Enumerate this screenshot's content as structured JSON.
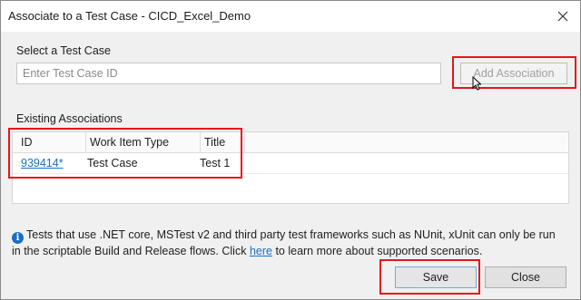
{
  "window": {
    "title": "Associate to a Test Case - CICD_Excel_Demo"
  },
  "select_section": {
    "label": "Select a Test Case",
    "input_placeholder": "Enter Test Case ID",
    "input_value": "",
    "add_button_label": "Add Association"
  },
  "associations": {
    "label": "Existing Associations",
    "columns": [
      "ID",
      "Work Item Type",
      "Title"
    ],
    "rows": [
      {
        "id": "939414*",
        "work_item_type": "Test Case",
        "title": "Test 1"
      }
    ]
  },
  "info": {
    "text_before_link": "Tests that use .NET core, MSTest v2 and third party test frameworks such as NUnit, xUnit can only be run in the scriptable Build and Release flows. Click ",
    "link_text": "here",
    "text_after_link": " to learn more about supported scenarios."
  },
  "footer": {
    "save_label": "Save",
    "close_label": "Close"
  },
  "colors": {
    "highlight": "#e8141b",
    "link": "#1a6fc4"
  },
  "icons": {
    "close": "close-icon",
    "info": "info-icon",
    "cursor": "mouse-cursor-icon"
  }
}
